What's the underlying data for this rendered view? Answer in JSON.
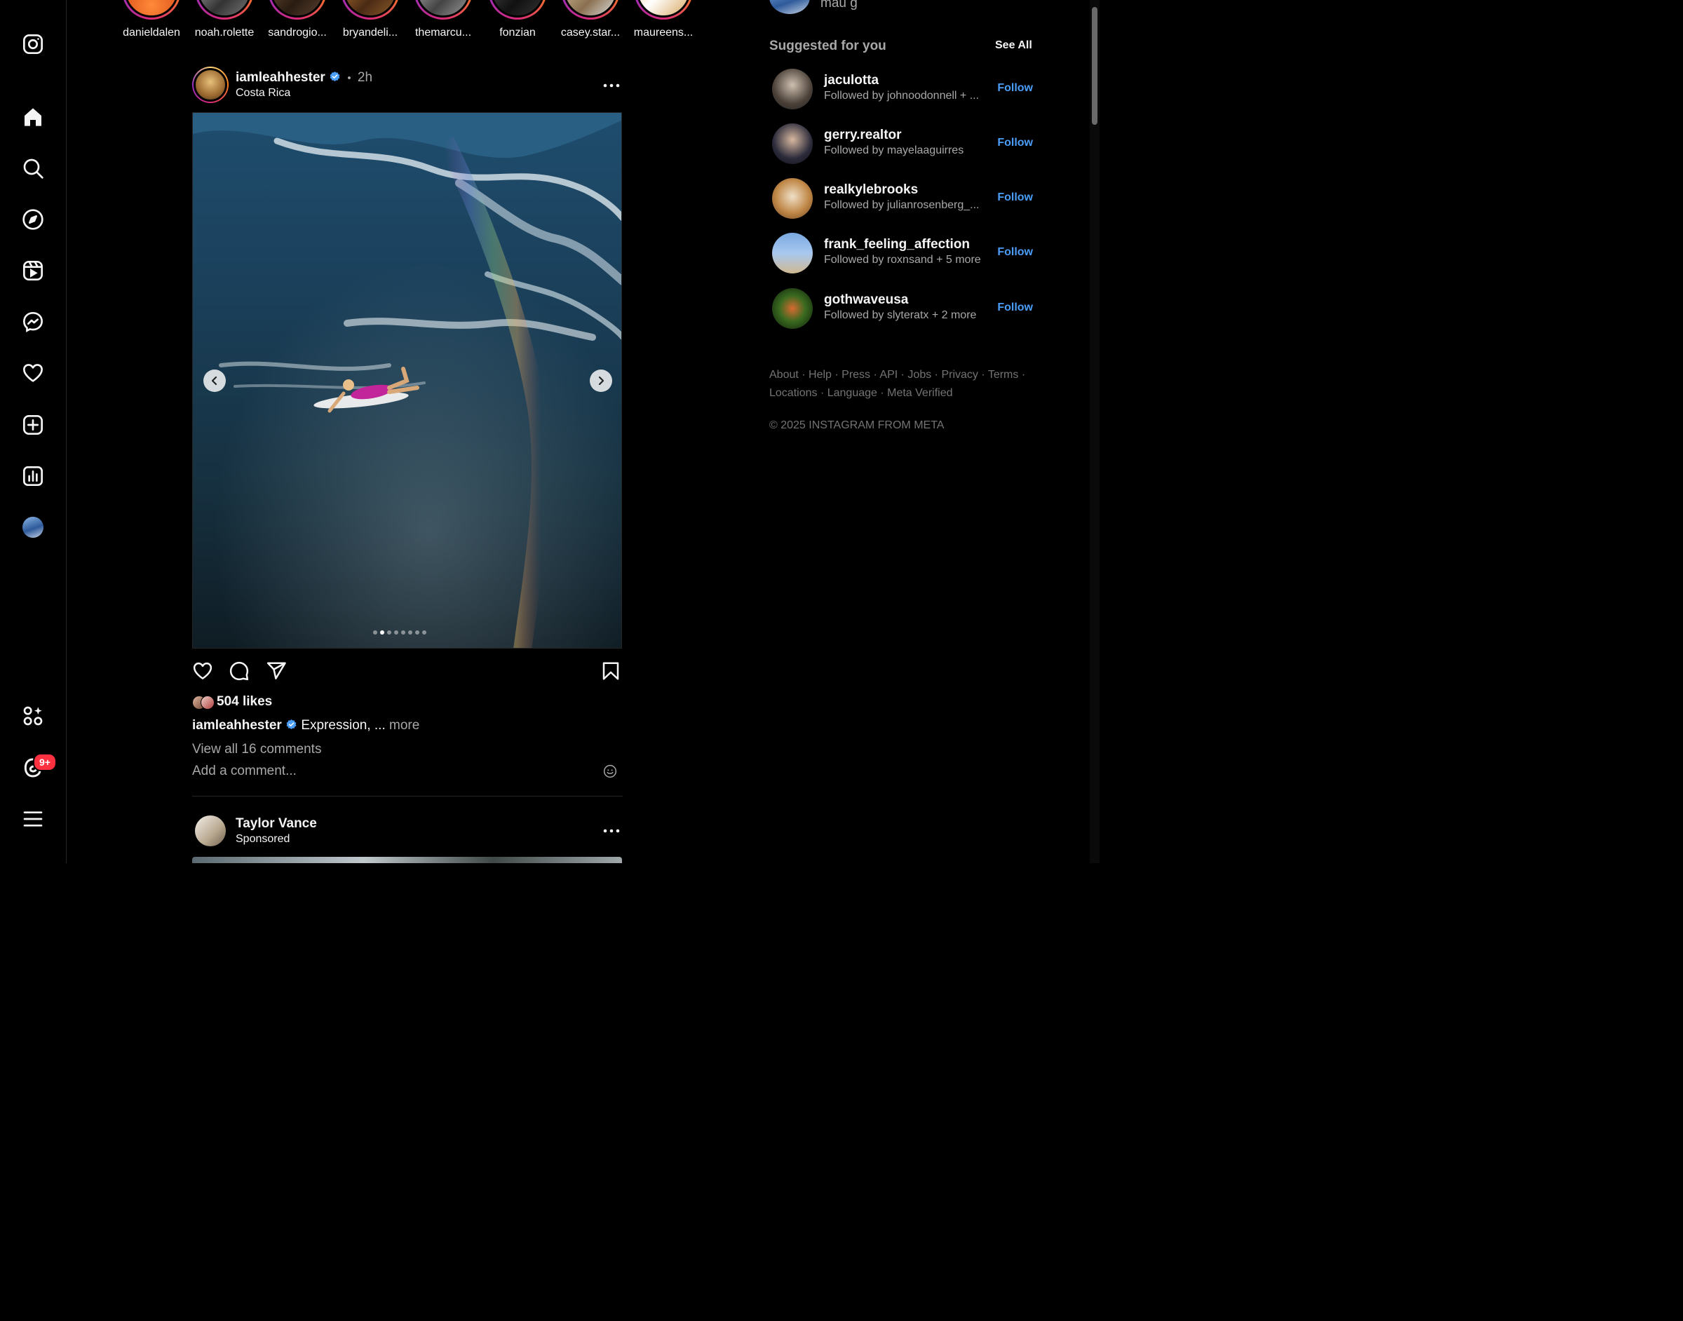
{
  "stories": [
    {
      "name": "danieldalen"
    },
    {
      "name": "noah.rolette"
    },
    {
      "name": "sandrogio..."
    },
    {
      "name": "bryandeli..."
    },
    {
      "name": "themarcu..."
    },
    {
      "name": "fonzian"
    },
    {
      "name": "casey.star..."
    },
    {
      "name": "maureens..."
    }
  ],
  "post": {
    "username": "iamleahhester",
    "time": "2h",
    "separator": "•",
    "location": "Costa Rica",
    "likes": "504 likes",
    "caption_user": "iamleahhester",
    "caption_text": "Expression, ...",
    "more": "more",
    "view_comments": "View all 16 comments",
    "comment_placeholder": "Add a comment...",
    "carousel_count": 8,
    "carousel_active": 1
  },
  "next_post": {
    "username": "Taylor Vance",
    "subtitle": "Sponsored"
  },
  "current_user": {
    "name": "mau g"
  },
  "suggestions": {
    "title": "Suggested for you",
    "see_all": "See All",
    "follow_label": "Follow",
    "items": [
      {
        "username": "jaculotta",
        "sub": "Followed by johnoodonnell + ..."
      },
      {
        "username": "gerry.realtor",
        "sub": "Followed by mayelaaguirres"
      },
      {
        "username": "realkylebrooks",
        "sub": "Followed by julianrosenberg_..."
      },
      {
        "username": "frank_feeling_affection",
        "sub": "Followed by roxnsand + 5 more"
      },
      {
        "username": "gothwaveusa",
        "sub": "Followed by slyteratx + 2 more"
      }
    ]
  },
  "footer": {
    "links": [
      "About",
      "Help",
      "Press",
      "API",
      "Jobs",
      "Privacy",
      "Terms",
      "Locations",
      "Language",
      "Meta Verified"
    ],
    "copyright": "© 2025 INSTAGRAM FROM META"
  },
  "nav": {
    "notification_badge": "9+",
    "icons": [
      "instagram-logo-icon",
      "home-icon",
      "search-icon",
      "explore-icon",
      "reels-icon",
      "messenger-icon",
      "heart-icon",
      "create-icon",
      "dashboard-icon",
      "profile-avatar",
      "also-from-meta-icon",
      "threads-icon",
      "menu-icon"
    ]
  },
  "colors": {
    "accent": "#4a9df8",
    "badge": "#ff3040",
    "background": "#000000",
    "muted": "#a8a8a8"
  }
}
